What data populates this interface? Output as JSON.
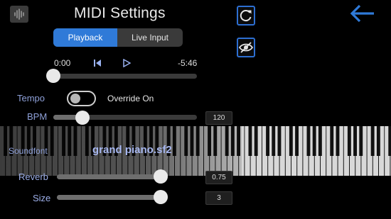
{
  "header": {
    "title": "MIDI Settings",
    "app_icon": "waveform-icon",
    "refresh_icon": "refresh-icon",
    "visibility_icon": "eye-off-icon",
    "back_icon": "back-arrow-icon",
    "accent_color": "#2f7ad8"
  },
  "tabs": {
    "playback": "Playback",
    "live_input": "Live Input",
    "selected": "Playback"
  },
  "playback": {
    "current_time": "0:00",
    "remaining_time": "-5:46",
    "skip_icon": "skip-back-icon",
    "play_icon": "play-icon",
    "progress": 0
  },
  "tempo": {
    "label": "Tempo",
    "override_label": "Override On",
    "override_enabled": false
  },
  "bpm": {
    "label": "BPM",
    "value": "120",
    "level": 0.2
  },
  "soundfont": {
    "label": "Soundfont",
    "value": "grand piano.sf2"
  },
  "reverb": {
    "label": "Reverb",
    "value": "0.75",
    "level": 0.98
  },
  "size": {
    "label": "Size",
    "value": "3",
    "level": 0.98
  }
}
